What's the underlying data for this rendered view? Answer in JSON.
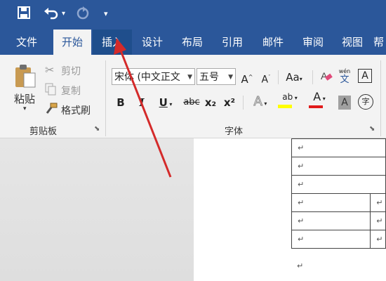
{
  "tabs": [
    "文件",
    "开始",
    "插入",
    "设计",
    "布局",
    "引用",
    "邮件",
    "审阅",
    "视图",
    "帮"
  ],
  "clipboard": {
    "paste": "粘贴",
    "cut": "剪切",
    "copy": "复制",
    "format_painter": "格式刷",
    "group_label": "剪贴板"
  },
  "font": {
    "font_name": "宋体 (中文正文",
    "font_size": "五号",
    "group_label": "字体",
    "bold": "B",
    "italic": "I",
    "underline": "U",
    "strikethrough": "abc",
    "subscript": "x₂",
    "superscript": "x²",
    "change_case": "Aa",
    "phonetic_top": "wén",
    "phonetic_bottom": "文",
    "char_border": "A",
    "grow": "A",
    "shrink": "A",
    "text_effects": "A",
    "highlight": "ab",
    "font_color": "A",
    "char_shading": "A",
    "enclose": "字"
  },
  "paragraph_mark": "↵",
  "colors": {
    "ribbon_blue": "#2b579a",
    "highlight_yellow": "#ffff00",
    "font_color_red": "#e11b1b",
    "annotation_arrow": "#d42a2a"
  },
  "icons": [
    "save-icon",
    "undo-icon",
    "redo-icon",
    "customize-qat-icon",
    "paste-icon",
    "cut-icon",
    "copy-icon",
    "format-painter-icon",
    "clear-formatting-icon",
    "dialog-launcher-icon"
  ]
}
